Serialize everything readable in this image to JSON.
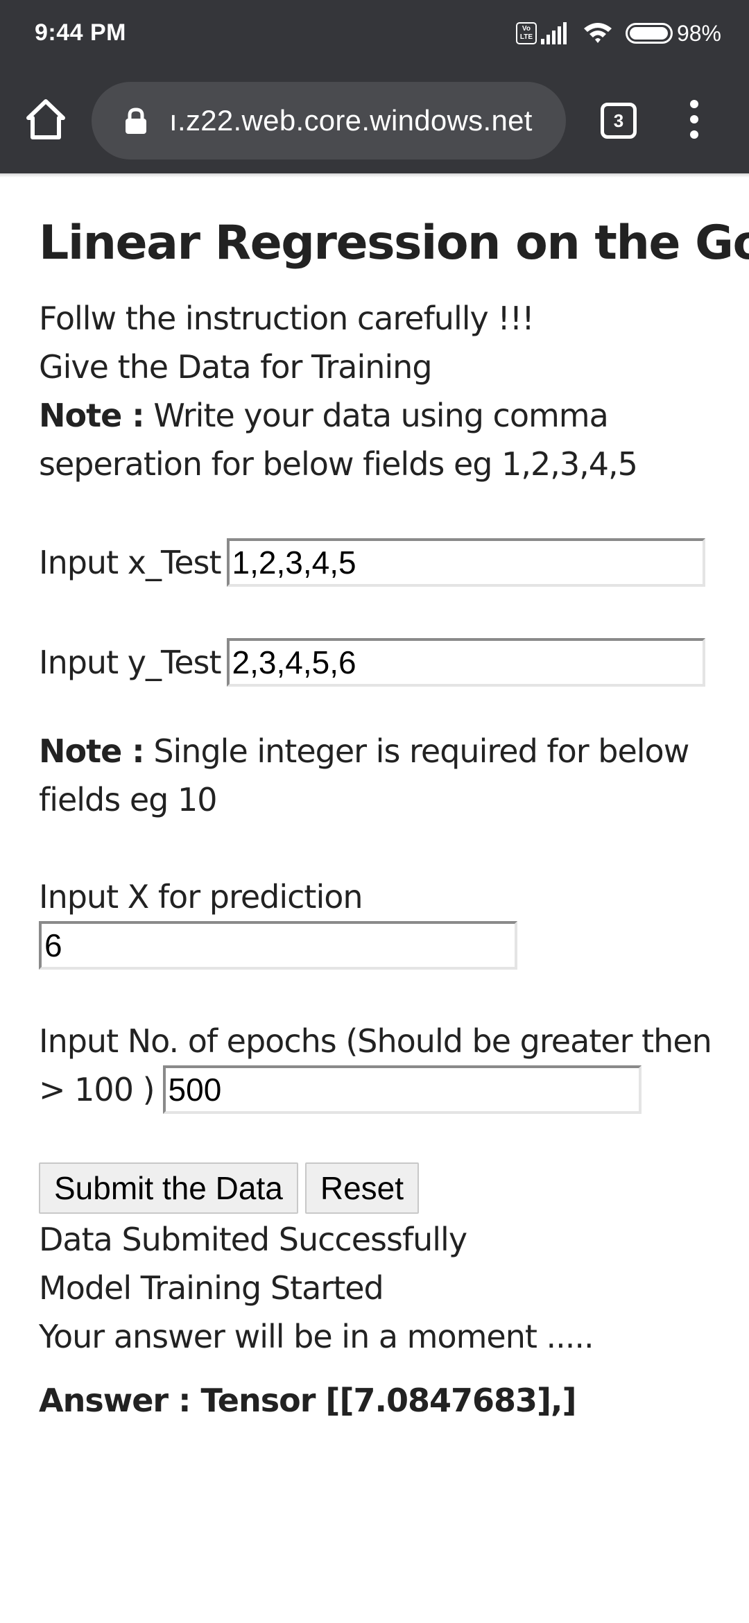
{
  "status_bar": {
    "time": "9:44 PM",
    "volte_label_top": "Vo",
    "volte_label_bottom": "LTE",
    "battery_level": 0.98,
    "battery_text": "98%"
  },
  "browser": {
    "url": "ı.z22.web.core.windows.net",
    "tab_count": "3",
    "icons": {
      "home": "home-icon",
      "lock": "lock-icon",
      "tabs": "tab-switcher-icon",
      "menu": "more-vert-icon"
    }
  },
  "page": {
    "title": "Linear Regression on the Go",
    "intro_line1": "Follw the instruction carefully !!!",
    "intro_line2": "Give the Data for Training",
    "note_label": "Note :",
    "note1_text": " Write your data using comma seperation for below fields eg 1,2,3,4,5",
    "x_test_label": "Input x_Test",
    "x_test_value": "1,2,3,4,5",
    "y_test_label": "Input y_Test",
    "y_test_value": "2,3,4,5,6",
    "note2_text": " Single integer is required for below fields eg 10",
    "x_predict_label": "Input X for prediction",
    "x_predict_value": "6",
    "epochs_label_line1": "Input No. of epochs (Should be greater then",
    "epochs_label_line2": "> 100 )",
    "epochs_value": "500",
    "submit_label": "Submit the Data",
    "reset_label": "Reset",
    "status_line1": "Data Submited Successfully",
    "status_line2": "Model Training Started",
    "status_line3": "Your answer will be in a moment .....",
    "answer": "Answer : Tensor [[7.0847683],]"
  },
  "colors": {
    "chrome_dark": "#35363a",
    "url_pill": "#4a4b4f",
    "text": "#222222",
    "button_bg": "#efefef"
  }
}
